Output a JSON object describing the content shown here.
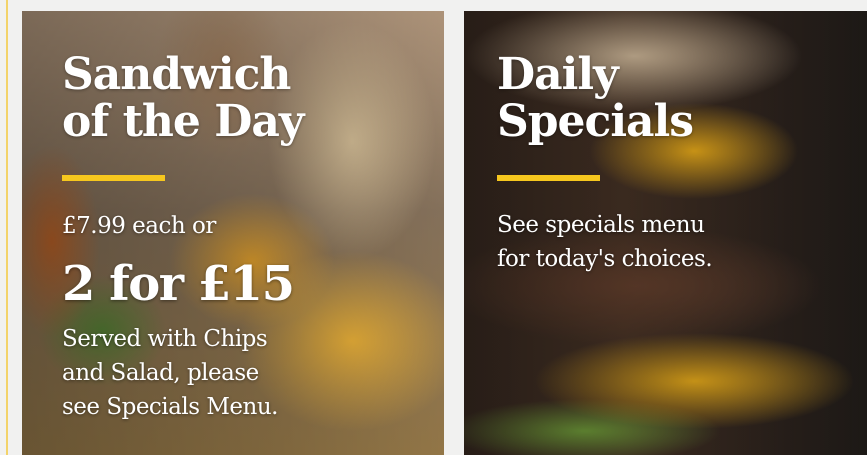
{
  "colors": {
    "accent": "#f6c71e",
    "page_bg": "#f1f1f0",
    "text": "#ffffff"
  },
  "cards": [
    {
      "heading_line1": "Sandwich",
      "heading_line2": "of the Day",
      "price": "£7.99 each or",
      "deal": "2 for £15",
      "served_line1": "Served with Chips",
      "served_line2": "and Salad, please",
      "served_line3": "see Specials Menu."
    },
    {
      "heading_line1": "Daily",
      "heading_line2": "Specials",
      "desc_line1": "See specials menu",
      "desc_line2": "for today's choices."
    }
  ]
}
